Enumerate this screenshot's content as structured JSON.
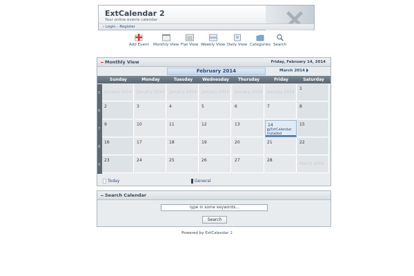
{
  "header": {
    "title": "ExtCalendar 2",
    "subtitle": "Your online events calendar",
    "nav": {
      "login": "Login",
      "register": "Register"
    }
  },
  "toolbar": [
    {
      "label": "Add Event",
      "icon": "add-event-icon"
    },
    {
      "label": "Monthly View",
      "icon": "monthly-view-icon"
    },
    {
      "label": "Flat View",
      "icon": "flat-view-icon"
    },
    {
      "label": "Weekly View",
      "icon": "weekly-view-icon"
    },
    {
      "label": "Daily View",
      "icon": "daily-view-icon"
    },
    {
      "label": "Categories",
      "icon": "categories-icon"
    },
    {
      "label": "Search",
      "icon": "search-icon"
    }
  ],
  "calendar": {
    "panel_title": "Monthly View",
    "date": "Friday, February 14, 2014",
    "current_month": "February 2014",
    "next_month": "March 2014",
    "weekdays": [
      "Sunday",
      "Monday",
      "Tuesday",
      "Wednesday",
      "Thursday",
      "Friday",
      "Saturday"
    ],
    "weeks": [
      {
        "num": "5",
        "days": [
          {
            "label": "January 2014",
            "type": "other"
          },
          {
            "label": "January 2014",
            "type": "other"
          },
          {
            "label": "January 2014",
            "type": "other"
          },
          {
            "label": "January 2014",
            "type": "other"
          },
          {
            "label": "January 2014",
            "type": "other"
          },
          {
            "label": "January 2014",
            "type": "other"
          },
          {
            "label": "1",
            "type": "day"
          }
        ]
      },
      {
        "num": "6",
        "days": [
          {
            "label": "2"
          },
          {
            "label": "3"
          },
          {
            "label": "4"
          },
          {
            "label": "5"
          },
          {
            "label": "6"
          },
          {
            "label": "7"
          },
          {
            "label": "8"
          }
        ]
      },
      {
        "num": "7",
        "days": [
          {
            "label": "9"
          },
          {
            "label": "10"
          },
          {
            "label": "11"
          },
          {
            "label": "12"
          },
          {
            "label": "13"
          },
          {
            "label": "14",
            "today": true,
            "event": "ExtCalendar Installed"
          },
          {
            "label": "15"
          }
        ]
      },
      {
        "num": "8",
        "days": [
          {
            "label": "16"
          },
          {
            "label": "17"
          },
          {
            "label": "18"
          },
          {
            "label": "19"
          },
          {
            "label": "20"
          },
          {
            "label": "21"
          },
          {
            "label": "22"
          }
        ]
      },
      {
        "num": "9",
        "days": [
          {
            "label": "23"
          },
          {
            "label": "24"
          },
          {
            "label": "25"
          },
          {
            "label": "26"
          },
          {
            "label": "27"
          },
          {
            "label": "28"
          },
          {
            "label": "March 2014",
            "type": "other"
          }
        ]
      }
    ],
    "legend": {
      "today": "Today",
      "general": "General"
    }
  },
  "search": {
    "panel_title": "Search Calendar",
    "placeholder": "Type in some keywords...",
    "button": "Search"
  },
  "footer": {
    "prefix": "Powered by",
    "name": "ExtCalendar",
    "version": "2"
  },
  "colors": {
    "accent": "#2d4f7c",
    "today_bar": "#3e6ea6",
    "header_bar": "#5a6670"
  }
}
